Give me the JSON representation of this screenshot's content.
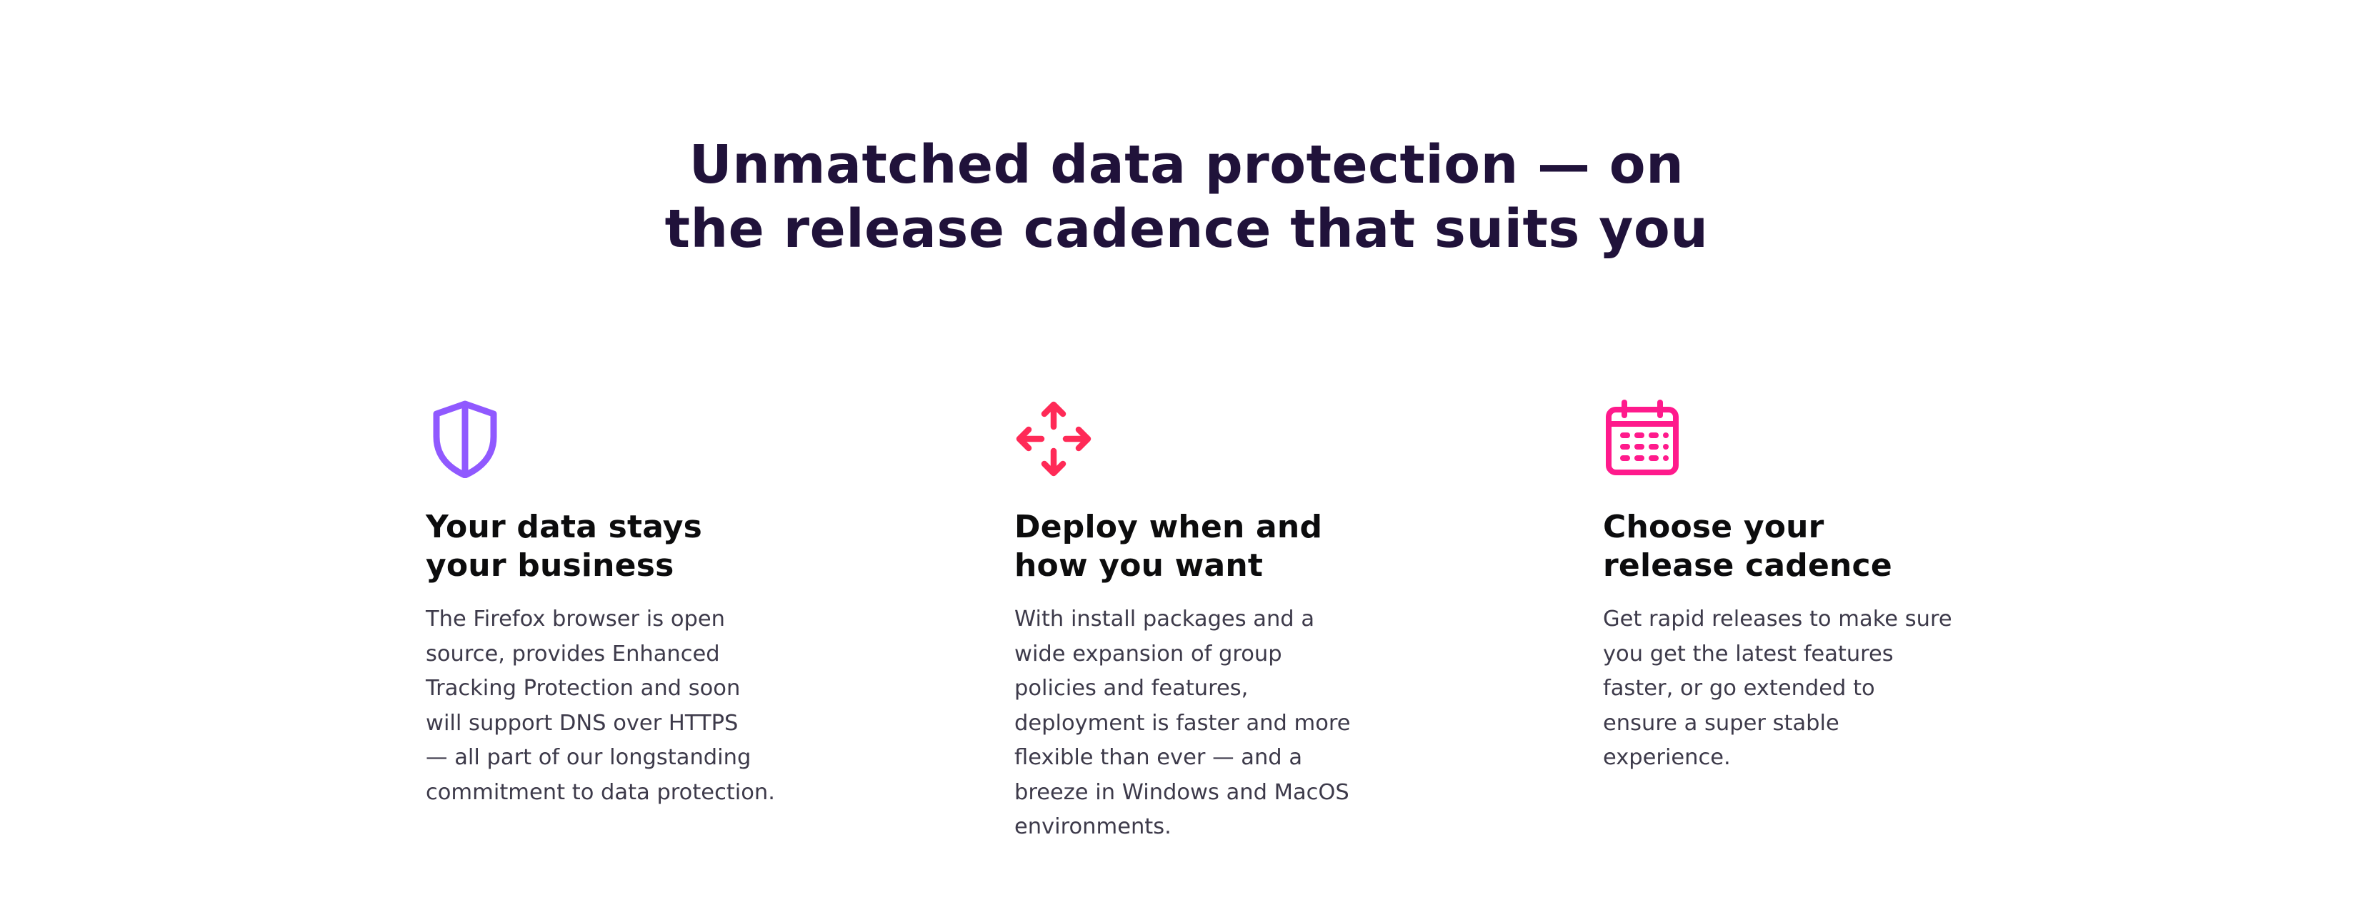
{
  "headline": {
    "lines": [
      "Unmatched data protection — on",
      "the release cadence that suits you"
    ]
  },
  "colors": {
    "headline": "#20123a",
    "title": "#0c0c0d",
    "body": "#3d3a4a",
    "shield_icon": "#9059ff",
    "move_icon": "#ff2a57",
    "calendar_icon": "#ff1a8c"
  },
  "features": [
    {
      "icon": "shield-icon",
      "title_lines": [
        "Your data stays",
        "your business"
      ],
      "body_lines": [
        "The Firefox browser is open",
        "source, provides Enhanced",
        "Tracking Protection and soon",
        "will support DNS over HTTPS",
        "— all part of our longstanding",
        "commitment to data protection."
      ]
    },
    {
      "icon": "move-arrows-icon",
      "title_lines": [
        "Deploy when and",
        "how you want"
      ],
      "body_lines": [
        "With install packages and a",
        "wide expansion of group",
        "policies and features,",
        "deployment is faster and more",
        "flexible than ever — and a",
        "breeze in Windows and MacOS",
        "environments."
      ]
    },
    {
      "icon": "calendar-icon",
      "title_lines": [
        "Choose your",
        "release cadence"
      ],
      "body_lines": [
        "Get rapid releases to make sure",
        "you get the latest features",
        "faster, or go extended to",
        "ensure a super stable",
        "experience."
      ]
    }
  ]
}
